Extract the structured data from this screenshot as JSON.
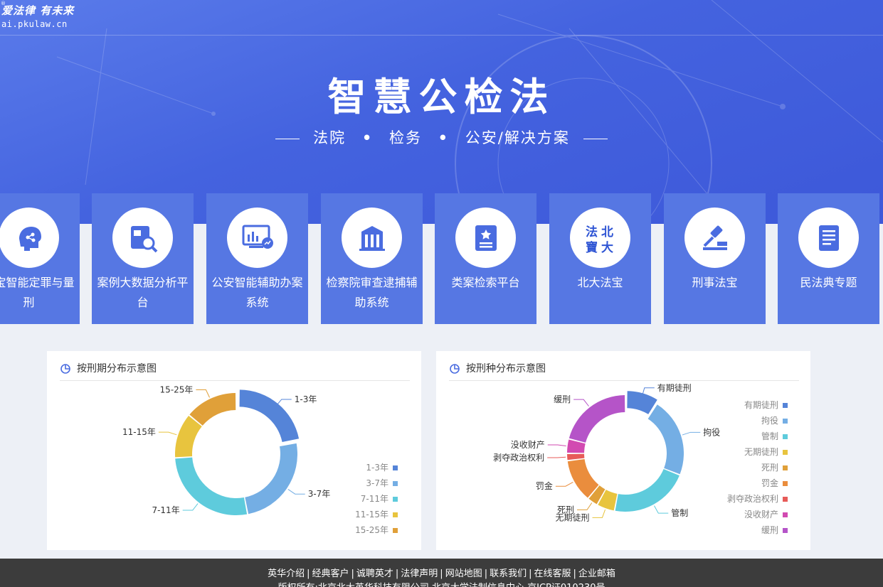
{
  "logo": {
    "slogan": "爱法律 有未来",
    "domain": "ai.pkulaw.cn",
    "reg": "®"
  },
  "hero": {
    "title": "智慧公检法",
    "subtitle_parts": [
      "法院",
      "检务",
      "公安/解决方案"
    ]
  },
  "cards": [
    {
      "label": "法宝智能定罪与量刑",
      "icon": "brain-share-icon"
    },
    {
      "label": "案例大数据分析平台",
      "icon": "document-search-icon"
    },
    {
      "label": "公安智能辅助办案系统",
      "icon": "monitor-chart-icon"
    },
    {
      "label": "检察院审查逮捕辅助系统",
      "icon": "courthouse-icon"
    },
    {
      "label": "类案检索平台",
      "icon": "badge-document-icon"
    },
    {
      "label": "北大法宝",
      "icon": "pkulaw-logo-icon",
      "logo_text": [
        "法",
        "北",
        "寶",
        "大"
      ]
    },
    {
      "label": "刑事法宝",
      "icon": "gavel-icon"
    },
    {
      "label": "民法典专题",
      "icon": "book-icon"
    }
  ],
  "panels": {
    "left_title": "按刑期分布示意图",
    "right_title": "按刑种分布示意图"
  },
  "chart_data": [
    {
      "type": "pie",
      "title": "按刑期分布示意图",
      "categories": [
        "1-3年",
        "3-7年",
        "7-11年",
        "11-15年",
        "15-25年"
      ],
      "values": [
        22,
        25,
        27,
        12,
        14
      ],
      "colors": [
        "#5584d8",
        "#74aee4",
        "#5ecbdc",
        "#e8c43e",
        "#e0a039"
      ],
      "legend_position": "bottom-right",
      "highlighted": "1-3年"
    },
    {
      "type": "pie",
      "title": "按刑种分布示意图",
      "categories": [
        "有期徒刑",
        "拘役",
        "管制",
        "无期徒刑",
        "死刑",
        "罚金",
        "剥夺政治权利",
        "没收财产",
        "缓刑"
      ],
      "values": [
        9,
        22,
        22,
        5,
        3,
        12,
        2,
        4,
        21
      ],
      "colors": [
        "#5584d8",
        "#74aee4",
        "#5ecbdc",
        "#e8c43e",
        "#e0a039",
        "#ea8d3d",
        "#e75b59",
        "#d24ab1",
        "#b554c8"
      ],
      "legend_position": "right",
      "highlighted": "有期徒刑"
    }
  ],
  "footer": {
    "links": [
      "英华介绍",
      "经典客户",
      "诚聘英才",
      "法律声明",
      "网站地图",
      "联系我们",
      "在线客服",
      "企业邮箱"
    ],
    "copyright": "版权所有:北京北大英华科技有限公司 北京大学法制信息中心 京ICP证010230号"
  }
}
